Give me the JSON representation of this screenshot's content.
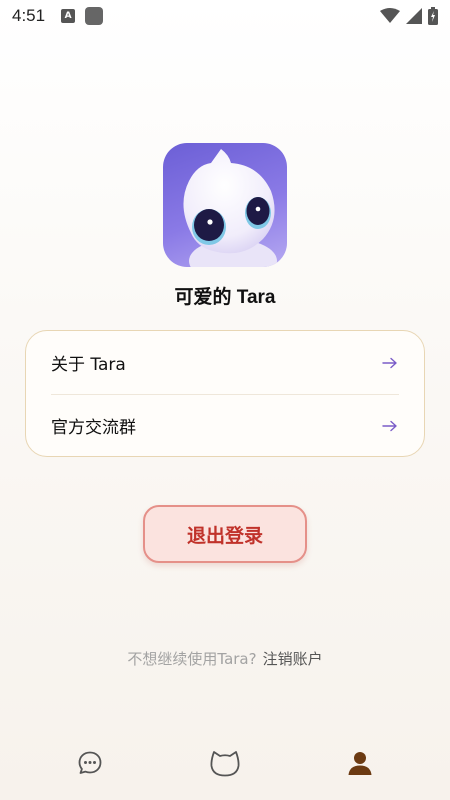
{
  "status_bar": {
    "time": "4:51",
    "notification_badge": "A"
  },
  "app": {
    "name": "可爱的 Tara",
    "logo_icon": "tara-cat-logo"
  },
  "menu": {
    "items": [
      {
        "label": "关于 Tara",
        "icon": "arrow-right-icon"
      },
      {
        "label": "官方交流群",
        "icon": "arrow-right-icon"
      }
    ],
    "accent_color": "#7a5cc8"
  },
  "logout": {
    "label": "退出登录",
    "text_color": "#c0322a",
    "border_color": "#e59089"
  },
  "deactivate": {
    "prompt": "不想继续使用Tara?",
    "link": "注销账户"
  },
  "tabs": [
    {
      "name": "chat",
      "icon": "chat-bubble-icon",
      "active": false
    },
    {
      "name": "home",
      "icon": "cat-head-icon",
      "active": false
    },
    {
      "name": "profile",
      "icon": "person-icon",
      "active": true
    }
  ],
  "active_tab_color": "#6b3a12"
}
